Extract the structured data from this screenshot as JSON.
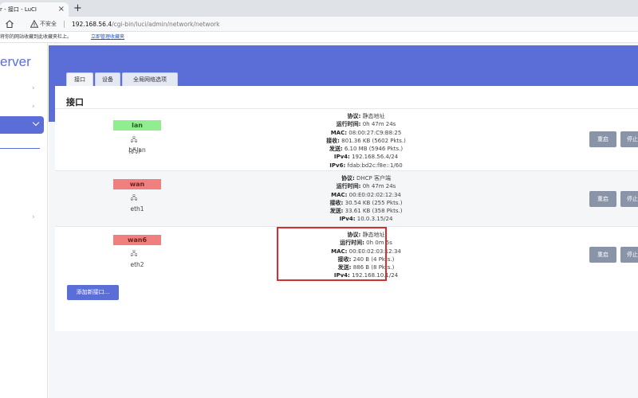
{
  "browser": {
    "tab_title": "r - 接口 - LuCI",
    "new_tab_symbol": "+",
    "close_symbol": "×",
    "insecure_label": "不安全",
    "url_host": "192.168.56.4",
    "url_path": "/cgi-bin/luci/admin/network/network",
    "infobar_message": "将你的网站收藏到此收藏夹栏上。",
    "infobar_link": "立即管理收藏夹"
  },
  "sidebar": {
    "brand": "erver"
  },
  "subtabs": [
    {
      "label": "接口"
    },
    {
      "label": "设备"
    },
    {
      "label": "全局网络选项"
    }
  ],
  "page_title": "接口",
  "labels": {
    "protocol": "协议:",
    "uptime": "运行时间:",
    "mac": "MAC:",
    "rx": "接收:",
    "tx": "发送:",
    "ipv4": "IPv4:",
    "ipv6": "IPv6:"
  },
  "interfaces": [
    {
      "name": "lan",
      "icon_text": "🖧 (🖧)",
      "device": "br-lan",
      "protocol": "静态地址",
      "uptime": "0h 47m 24s",
      "mac": "08:00:27:C9:B8:25",
      "rx": "801.36 KB (5602 Pkts.)",
      "tx": "6.10 MB (5946 Pkts.)",
      "ipv4": "192.168.56.4/24",
      "ipv6": "fdab:bd2c:f8e::1/60"
    },
    {
      "name": "wan",
      "icon_text": "🖧",
      "device": "eth1",
      "protocol": "DHCP 客户端",
      "uptime": "0h 47m 24s",
      "mac": "00:E0:02:02:12:34",
      "rx": "30.54 KB (255 Pkts.)",
      "tx": "33.61 KB (358 Pkts.)",
      "ipv4": "10.0.3.15/24"
    },
    {
      "name": "wan6",
      "icon_text": "🖧",
      "device": "eth2",
      "protocol": "静态地址",
      "uptime": "0h 0m 5s",
      "mac": "00:E0:02:03:12:34",
      "rx": "240 B (4 Pkts.)",
      "tx": "886 B (8 Pkts.)",
      "ipv4": "192.168.10.1/24"
    }
  ],
  "buttons": {
    "restart": "重启",
    "stop": "停止",
    "add_interface": "添加新接口..."
  },
  "colors": {
    "accent": "#5b6ed8",
    "lan_badge": "#90ee90",
    "wan_badge": "#f08080",
    "highlight": "#d43030"
  }
}
